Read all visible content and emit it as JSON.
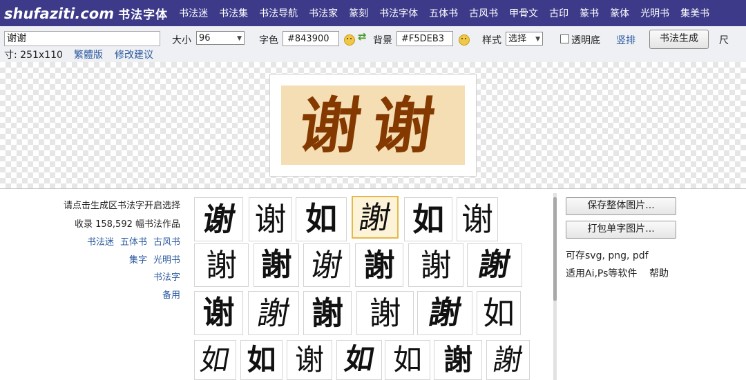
{
  "nav": {
    "logo": "shufaziti.com",
    "logo_cn": "书法字体",
    "links": [
      "书法迷",
      "书法集",
      "书法导航",
      "书法家",
      "篆刻",
      "书法字体",
      "五体书",
      "古风书",
      "甲骨文",
      "古印",
      "篆书",
      "篆体",
      "光明书",
      "集美书"
    ]
  },
  "toolbar": {
    "text_value": "谢谢",
    "size_label": "大小",
    "size_value": "96",
    "fg_label": "字色",
    "fg_value": "#843900",
    "bg_label": "背景",
    "bg_value": "#F5DEB3",
    "style_label": "样式",
    "style_value": "选择",
    "transparent_label": "透明底",
    "vertical_label": "竖排",
    "generate_label": "书法生成",
    "ruler_label": "尺",
    "dim_text": "寸: 251x110",
    "traditional_label": "繁體版",
    "suggest_label": "修改建议"
  },
  "preview": {
    "text": "谢谢",
    "fg": "#843900",
    "bg": "#F5DEB3"
  },
  "left_info": {
    "hint": "请点击生成区书法字开启选择",
    "count_text": "收录 158,592 幅书法作品",
    "links_row1": [
      "书法迷",
      "五体书",
      "古风书"
    ],
    "links_row2": [
      "集字",
      "光明书"
    ],
    "link_row3": "书法字",
    "link_row4": "备用"
  },
  "grid": {
    "rows": [
      [
        "谢",
        "谢",
        "如",
        "謝",
        "如",
        "谢"
      ],
      [
        "謝",
        "謝",
        "谢",
        "謝",
        "謝",
        "謝"
      ],
      [
        "谢",
        "謝",
        "謝",
        "謝",
        "謝",
        "如"
      ],
      [
        "如",
        "如",
        "谢",
        "如",
        "如",
        "謝",
        "謝"
      ]
    ]
  },
  "right_panel": {
    "save_all_label": "保存整体图片...",
    "pack_label": "打包单字图片...",
    "formats_text": "可存svg, png, pdf",
    "apps_text": "适用Ai,Ps等软件",
    "help_label": "帮助"
  }
}
